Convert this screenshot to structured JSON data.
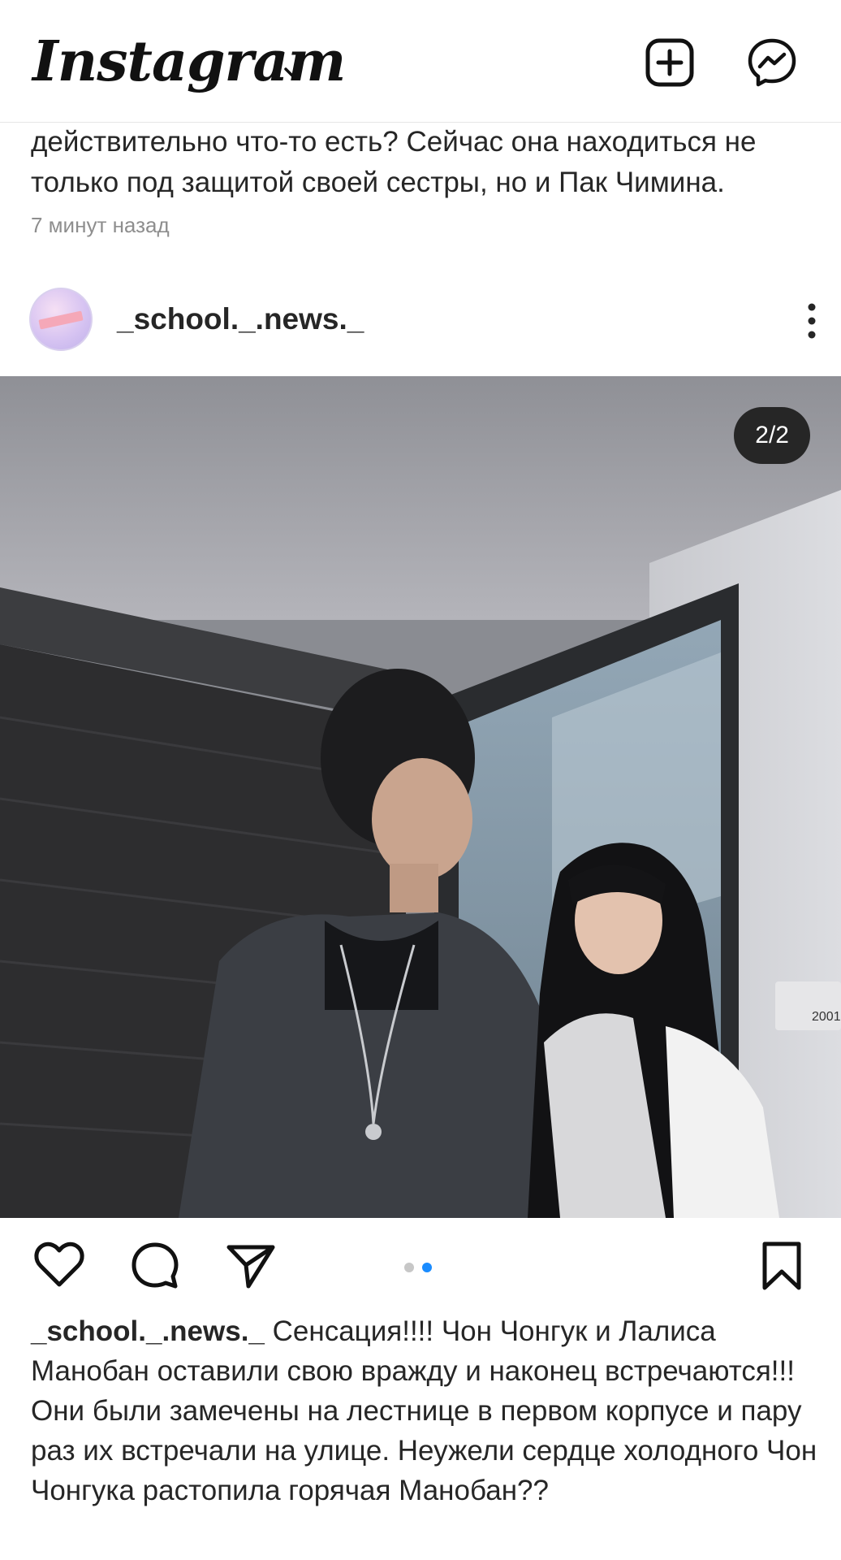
{
  "app": {
    "title": "Instagram"
  },
  "colors": {
    "accent_blue": "#1a8cff",
    "text_primary": "#262626",
    "text_secondary": "#8e8e8e"
  },
  "previous_post": {
    "caption": "действительно что-то есть? Сейчас она находиться не только под защитой своей сестры, но и Пак Чимина.",
    "time": "7 минут назад"
  },
  "post": {
    "username": "_school._.news._",
    "counter": "2/2",
    "carousel": {
      "count": 2,
      "active": 2
    },
    "caption_user": "_school._.news._",
    "caption_text": "Сенсация!!!! Чон Чонгук и Лалиса Манобан оставили свою вражду и наконец встречаются!!! Они были замечены на лестнице в первом корпусе и пару раз их встречали на улице. Неужели сердце холодного Чон Чонгука растопила горячая Манобан??"
  },
  "icons": {
    "header": [
      "chevron-down-icon",
      "new-post-icon",
      "messenger-icon"
    ],
    "post_header": [
      "more-options-icon"
    ],
    "actions": [
      "heart-icon",
      "comment-icon",
      "share-icon",
      "bookmark-icon"
    ]
  }
}
